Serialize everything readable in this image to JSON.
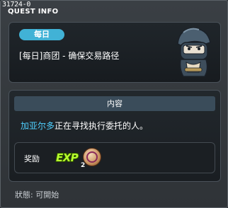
{
  "window": {
    "quest_id": "31724-0",
    "title": "QUEST INFO"
  },
  "header": {
    "badge": "每日",
    "quest_title": "[每日]商团 - 确保交易路径"
  },
  "content": {
    "section_title": "内容",
    "npc_name": "加亚尔多",
    "description_rest": "正在寻找执行委托的人。"
  },
  "reward": {
    "label": "奖励",
    "exp_text": "EXP",
    "item_count": "2"
  },
  "status": {
    "label": "狀態",
    "separator": ":",
    "value": "可開始"
  },
  "colors": {
    "badge": "#41b2d6",
    "npc_name": "#4fd0ff",
    "exp": "#b6ff2e"
  }
}
